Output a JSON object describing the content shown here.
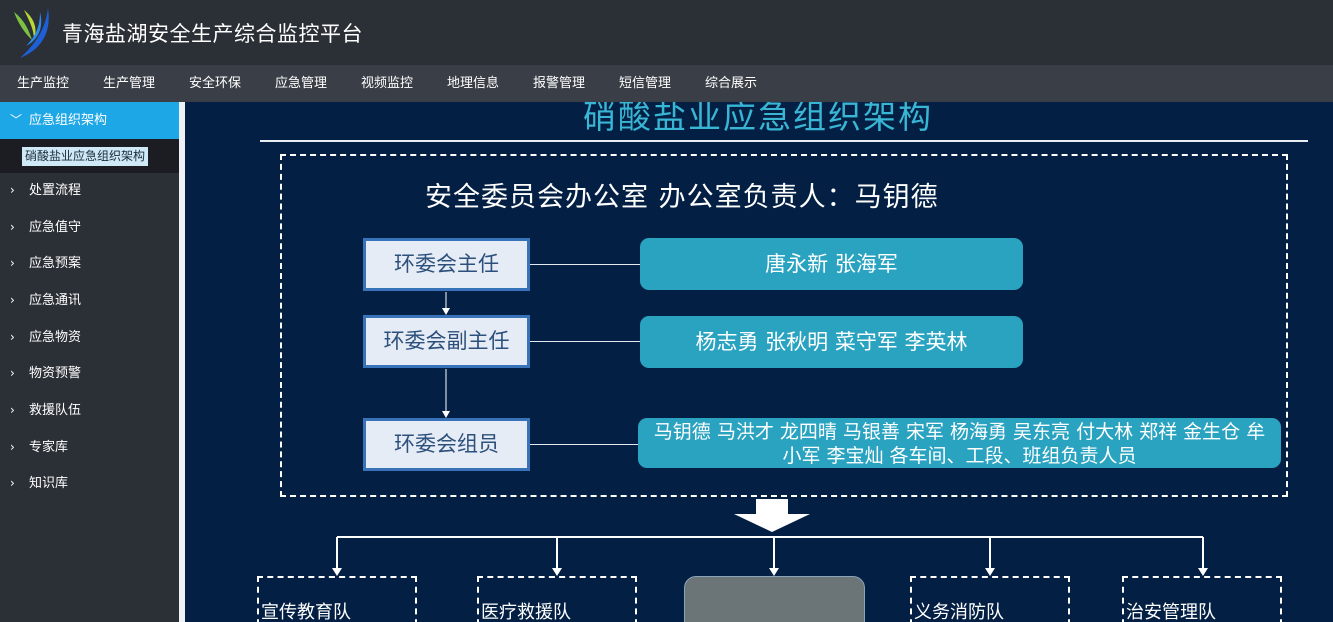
{
  "app": {
    "title": "青海盐湖安全生产综合监控平台"
  },
  "topnav": [
    "生产监控",
    "生产管理",
    "安全环保",
    "应急管理",
    "视频监控",
    "地理信息",
    "报警管理",
    "短信管理",
    "综合展示"
  ],
  "sidebar": {
    "active": {
      "label": "应急组织架构",
      "sub": "硝酸盐业应急组织架构"
    },
    "items": [
      "处置流程",
      "应急值守",
      "应急预案",
      "应急通讯",
      "应急物资",
      "物资预警",
      "救援队伍",
      "专家库",
      "知识库"
    ]
  },
  "org": {
    "title": "硝酸盐业应急组织架构",
    "office": "安全委员会办公室  办公室负责人：马钥德",
    "roles": [
      {
        "role": "环委会主任",
        "members": "唐永新  张海军"
      },
      {
        "role": "环委会副主任",
        "members": "杨志勇  张秋明  菜守军  李英林"
      },
      {
        "role": "环委会组员",
        "members": "马钥德  马洪才  龙四晴  马银善  宋军  杨海勇  吴东亮  付大林  郑祥  金生仓  牟小军  李宝灿  各车间、工段、班组负责人员"
      }
    ],
    "teams": [
      "宣传教育队",
      "医疗救援队",
      "义务消防队",
      "治安管理队"
    ]
  }
}
